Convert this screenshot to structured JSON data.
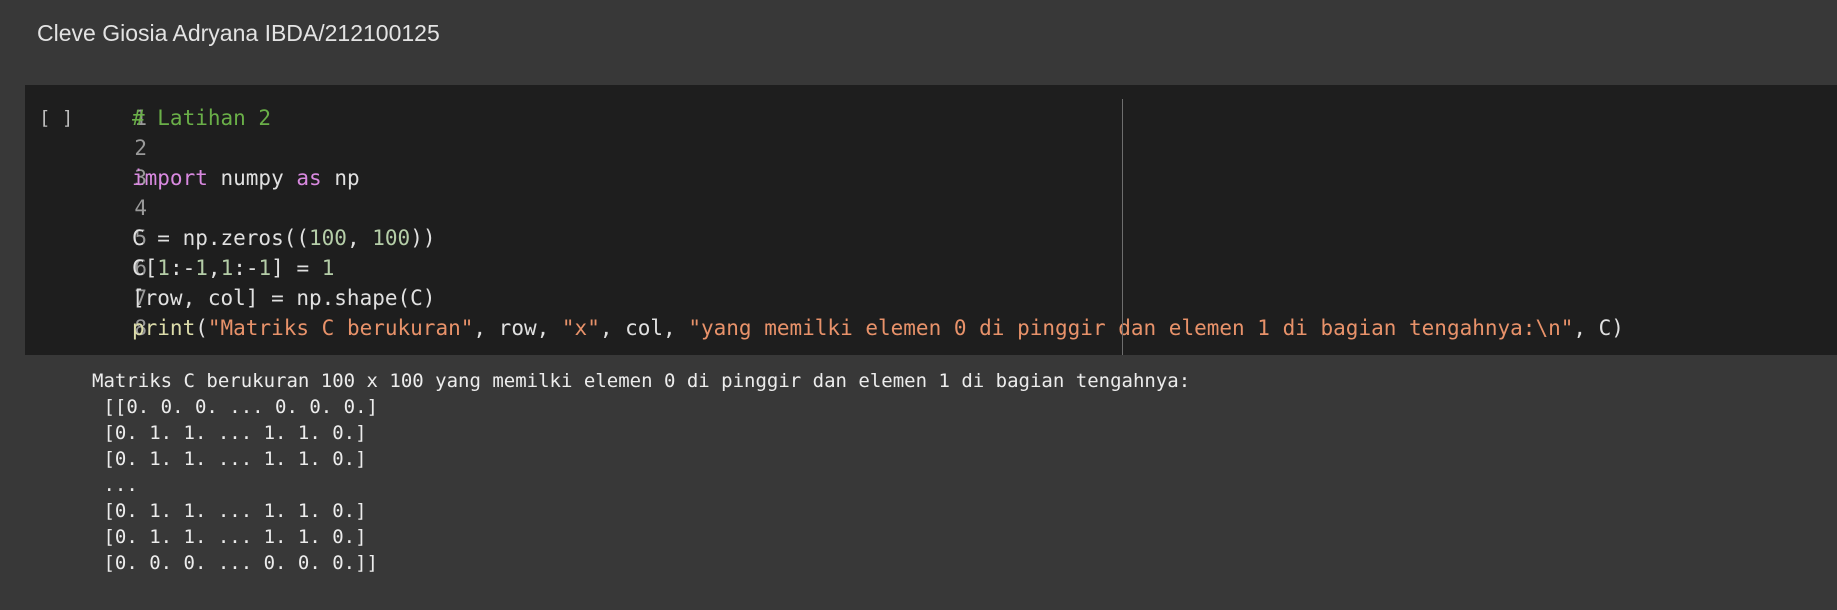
{
  "text_cell": {
    "content": "Cleve Giosia Adryana IBDA/212100125"
  },
  "code_cell": {
    "run_indicator": "[ ]",
    "line_numbers": [
      "1",
      "2",
      "3",
      "4",
      "5",
      "6",
      "7",
      "8"
    ],
    "lines": [
      [
        {
          "t": "comment",
          "v": "# Latihan 2"
        }
      ],
      [],
      [
        {
          "t": "keyword",
          "v": "import"
        },
        {
          "t": "plain",
          "v": " numpy "
        },
        {
          "t": "keyword",
          "v": "as"
        },
        {
          "t": "plain",
          "v": " np"
        }
      ],
      [],
      [
        {
          "t": "plain",
          "v": "C = np.zeros(("
        },
        {
          "t": "number",
          "v": "100"
        },
        {
          "t": "plain",
          "v": ", "
        },
        {
          "t": "number",
          "v": "100"
        },
        {
          "t": "plain",
          "v": "))"
        }
      ],
      [
        {
          "t": "plain",
          "v": "C["
        },
        {
          "t": "number",
          "v": "1"
        },
        {
          "t": "plain",
          "v": ":-"
        },
        {
          "t": "number",
          "v": "1"
        },
        {
          "t": "plain",
          "v": ","
        },
        {
          "t": "number",
          "v": "1"
        },
        {
          "t": "plain",
          "v": ":-"
        },
        {
          "t": "number",
          "v": "1"
        },
        {
          "t": "plain",
          "v": "] = "
        },
        {
          "t": "number",
          "v": "1"
        }
      ],
      [
        {
          "t": "plain",
          "v": "[row, col] = np.shape(C)"
        }
      ],
      [
        {
          "t": "builtin",
          "v": "print"
        },
        {
          "t": "plain",
          "v": "("
        },
        {
          "t": "string",
          "v": "\"Matriks C berukuran\""
        },
        {
          "t": "plain",
          "v": ", row, "
        },
        {
          "t": "string",
          "v": "\"x\""
        },
        {
          "t": "plain",
          "v": ", col, "
        },
        {
          "t": "string",
          "v": "\"yang memilki elemen 0 di pinggir dan elemen 1 di bagian tengahnya:\\n\""
        },
        {
          "t": "plain",
          "v": ", C)"
        }
      ]
    ]
  },
  "output": {
    "lines": [
      "Matriks C berukuran 100 x 100 yang memilki elemen 0 di pinggir dan elemen 1 di bagian tengahnya:",
      " [[0. 0. 0. ... 0. 0. 0.]",
      " [0. 1. 1. ... 1. 1. 0.]",
      " [0. 1. 1. ... 1. 1. 0.]",
      " ...",
      " [0. 1. 1. ... 1. 1. 0.]",
      " [0. 1. 1. ... 1. 1. 0.]",
      " [0. 0. 0. ... 0. 0. 0.]]"
    ]
  },
  "colors": {
    "background": "#383838",
    "editor_background": "#1e1e1e",
    "comment": "#6aaf48",
    "keyword": "#d989e0",
    "number": "#b5cea8",
    "string": "#e8926a",
    "builtin": "#dcdcaa"
  }
}
